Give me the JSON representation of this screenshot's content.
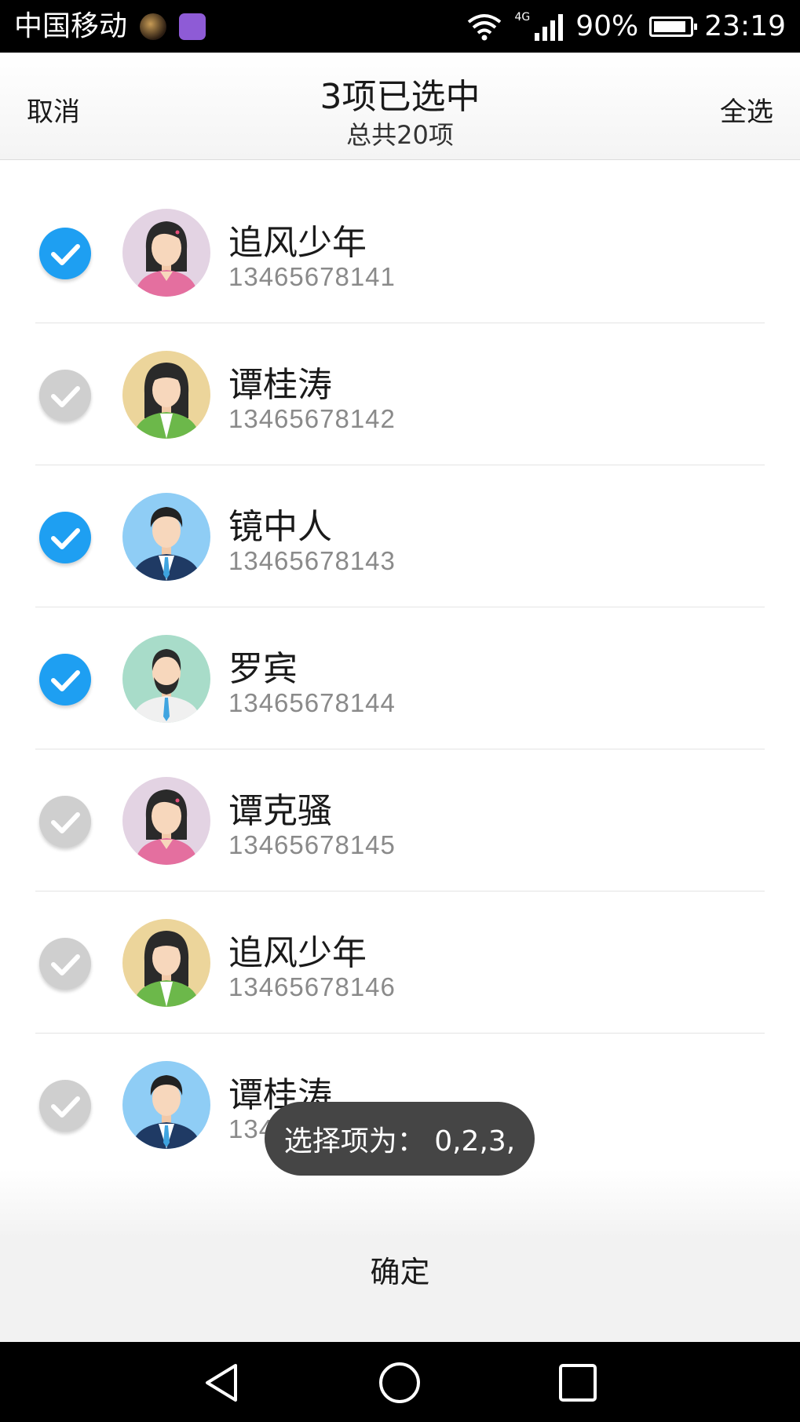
{
  "status_bar": {
    "carrier": "中国移动",
    "network": "4G",
    "battery": "90%",
    "battery_level": 0.9,
    "time": "23:19"
  },
  "header": {
    "cancel": "取消",
    "title": "3项已选中",
    "subtitle": "总共20项",
    "select_all": "全选"
  },
  "contacts": [
    {
      "name": "追风少年",
      "phone": "13465678141",
      "selected": true,
      "avatar": "female-pink"
    },
    {
      "name": "谭桂涛",
      "phone": "13465678142",
      "selected": false,
      "avatar": "female-green"
    },
    {
      "name": "镜中人",
      "phone": "13465678143",
      "selected": true,
      "avatar": "male-suit"
    },
    {
      "name": "罗宾",
      "phone": "13465678144",
      "selected": true,
      "avatar": "male-beard"
    },
    {
      "name": "谭克骚",
      "phone": "13465678145",
      "selected": false,
      "avatar": "female-pink"
    },
    {
      "name": "追风少年",
      "phone": "13465678146",
      "selected": false,
      "avatar": "female-green"
    },
    {
      "name": "谭桂涛",
      "phone": "13465678147",
      "selected": false,
      "avatar": "male-suit"
    }
  ],
  "toast": "选择项为：  0,2,3,",
  "confirm": "确定",
  "colors": {
    "accent": "#1e9ff2",
    "unchecked": "#cfcfcf"
  }
}
